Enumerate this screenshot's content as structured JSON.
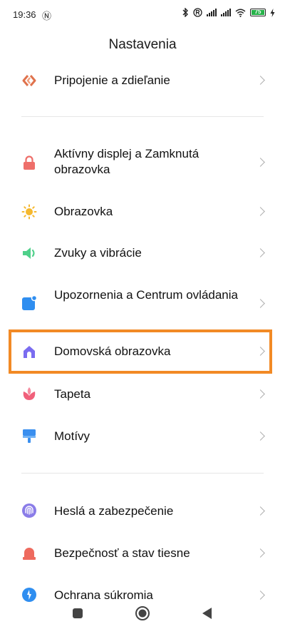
{
  "status_bar": {
    "time": "19:36",
    "nfc": "Ⓝ",
    "battery_level": "75"
  },
  "header": {
    "title": "Nastavenia"
  },
  "items": [
    {
      "label": "Pripojenie a zdieľanie",
      "icon": "share-icon",
      "color": "#e0734d"
    },
    {
      "label": "Aktívny displej a Zamknutá obrazovka",
      "icon": "lock-icon",
      "color": "#ee6f6a"
    },
    {
      "label": "Obrazovka",
      "icon": "sun-icon",
      "color": "#f5b82e"
    },
    {
      "label": "Zvuky a vibrácie",
      "icon": "speaker-icon",
      "color": "#4fd08a"
    },
    {
      "label": "Upozornenia a Centrum ovládania",
      "icon": "notification-icon",
      "color": "#2f8ef0"
    },
    {
      "label": "Domovská obrazovka",
      "icon": "home-icon",
      "color": "#7a6cf0"
    },
    {
      "label": "Tapeta",
      "icon": "flower-icon",
      "color": "#f0607a"
    },
    {
      "label": "Motívy",
      "icon": "brush-icon",
      "color": "#3a8fef"
    },
    {
      "label": "Heslá a zabezpečenie",
      "icon": "fingerprint-icon",
      "color": "#8a7ce8"
    },
    {
      "label": "Bezpečnosť a stav tiesne",
      "icon": "alarm-icon",
      "color": "#ee6a5e"
    },
    {
      "label": "Ochrana súkromia",
      "icon": "privacy-icon",
      "color": "#2f8ef0"
    }
  ],
  "highlight_color": "#f28a25"
}
